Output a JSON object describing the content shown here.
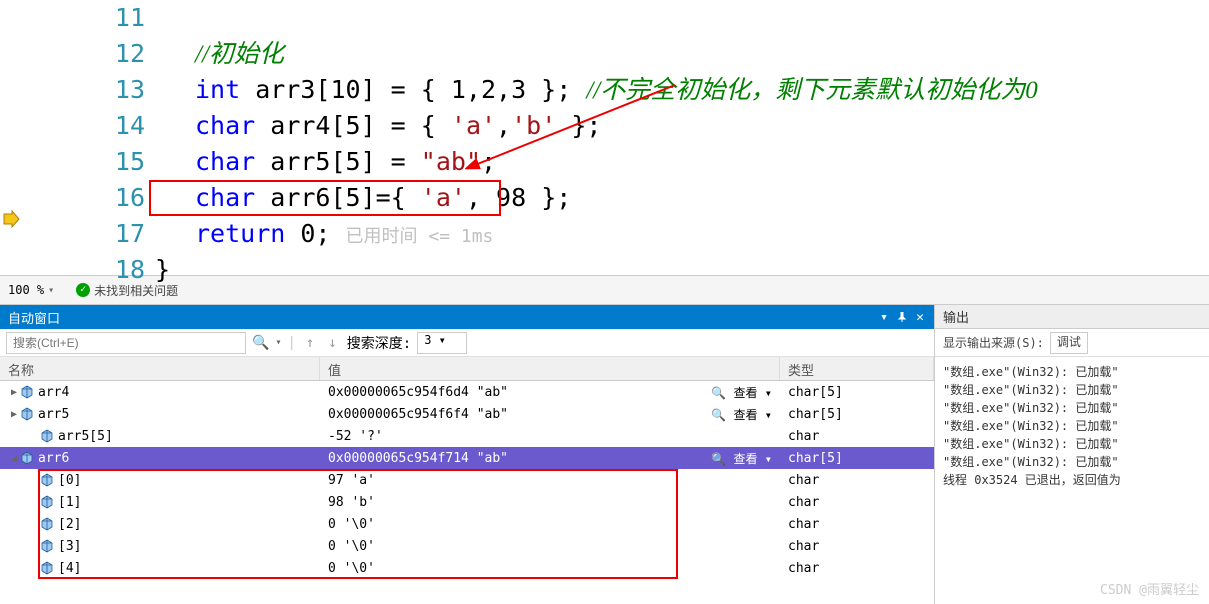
{
  "editor": {
    "lines": [
      11,
      12,
      13,
      14,
      15,
      16,
      17,
      18
    ],
    "zoom": "100 %",
    "status": "未找到相关问题",
    "comment1": "//初始化",
    "comment2": "//不完全初始化，剩下元素默认初始化为0",
    "l13_a": "int",
    "l13_b": " arr3[10] = { 1,2,3 }; ",
    "l14_a": "char",
    "l14_b": " arr4[5] = { ",
    "l14_c": "'a'",
    "l14_d": ",",
    "l14_e": "'b'",
    "l14_f": " };",
    "l15_a": "char",
    "l15_b": " arr5[5] = ",
    "l15_c": "\"ab\"",
    "l15_d": ";",
    "l16_a": "char",
    "l16_b": " arr6[5]={ ",
    "l16_c": "'a'",
    "l16_d": ", 98 };",
    "l17_a": "return",
    "l17_b": " 0;",
    "l17_hint": "已用时间 <= 1ms",
    "l18": "}"
  },
  "autos": {
    "title": "自动窗口",
    "search_placeholder": "搜索(Ctrl+E)",
    "depth_label": "搜索深度:",
    "depth_value": "3",
    "columns": {
      "name": "名称",
      "value": "值",
      "type": "类型"
    },
    "view_label": "查看",
    "rows": [
      {
        "expand": "▶",
        "indent": 0,
        "name": "arr4",
        "value": "0x00000065c954f6d4 \"ab\"",
        "type": "char[5]",
        "view": true
      },
      {
        "expand": "▶",
        "indent": 0,
        "name": "arr5",
        "value": "0x00000065c954f6f4 \"ab\"",
        "type": "char[5]",
        "view": true
      },
      {
        "expand": "",
        "indent": 1,
        "name": "arr5[5]",
        "value": "-52 '?'",
        "type": "char"
      },
      {
        "expand": "◢",
        "indent": 0,
        "name": "arr6",
        "value": "0x00000065c954f714 \"ab\"",
        "type": "char[5]",
        "view": true,
        "selected": true
      },
      {
        "expand": "",
        "indent": 1,
        "name": "[0]",
        "value": "97 'a'",
        "type": "char",
        "child": true
      },
      {
        "expand": "",
        "indent": 1,
        "name": "[1]",
        "value": "98 'b'",
        "type": "char",
        "child": true
      },
      {
        "expand": "",
        "indent": 1,
        "name": "[2]",
        "value": "0 '\\0'",
        "type": "char",
        "child": true
      },
      {
        "expand": "",
        "indent": 1,
        "name": "[3]",
        "value": "0 '\\0'",
        "type": "char",
        "child": true
      },
      {
        "expand": "",
        "indent": 1,
        "name": "[4]",
        "value": "0 '\\0'",
        "type": "char",
        "child": true
      }
    ]
  },
  "output": {
    "title": "输出",
    "source_label": "显示输出来源(S):",
    "source_value": "调试",
    "lines": [
      "\"数组.exe\"(Win32): 已加载\"",
      "\"数组.exe\"(Win32): 已加载\"",
      "\"数组.exe\"(Win32): 已加载\"",
      "\"数组.exe\"(Win32): 已加载\"",
      "\"数组.exe\"(Win32): 已加载\"",
      "\"数组.exe\"(Win32): 已加载\"",
      "线程 0x3524 已退出，返回值为"
    ]
  },
  "watermark": "CSDN @雨翼轻尘"
}
